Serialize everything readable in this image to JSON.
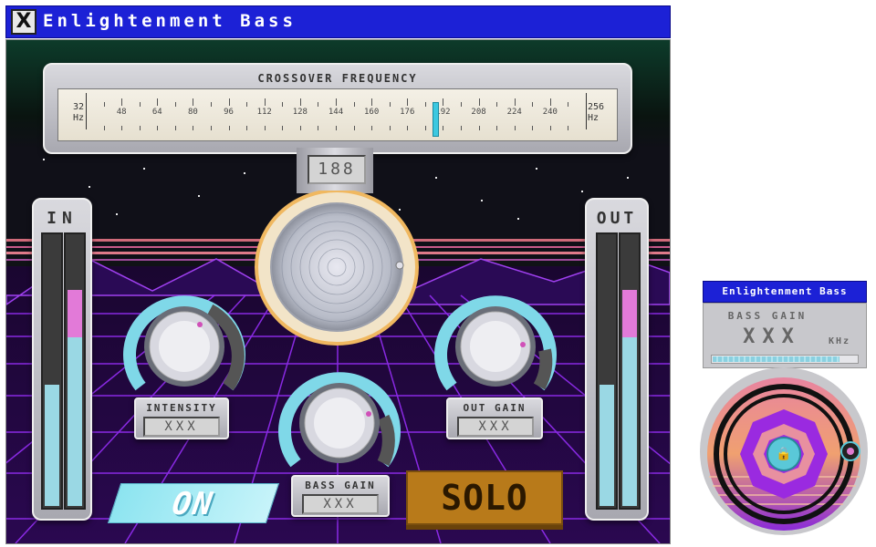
{
  "main_window": {
    "title": "Enlightenment Bass",
    "close_glyph": "X"
  },
  "crossover": {
    "label": "CROSSOVER FREQUENCY",
    "min_label": "32",
    "min_unit": "Hz",
    "max_label": "256",
    "max_unit": "Hz",
    "ticks": [
      "48",
      "64",
      "80",
      "96",
      "112",
      "128",
      "144",
      "160",
      "176",
      "192",
      "208",
      "224",
      "240"
    ],
    "value_display": "188",
    "value": 188
  },
  "in_meter": {
    "label": "IN",
    "left_level": 0.45,
    "right_level": 0.8
  },
  "out_meter": {
    "label": "OUT",
    "left_level": 0.45,
    "right_level": 0.8
  },
  "knobs": {
    "intensity": {
      "label": "INTENSITY",
      "value": "XXX"
    },
    "bass_gain": {
      "label": "BASS GAIN",
      "value": "XXX"
    },
    "out_gain": {
      "label": "OUT GAIN",
      "value": "XXX"
    }
  },
  "buttons": {
    "on": "ON",
    "solo": "SOLO"
  },
  "small_window": {
    "title": "Enlightenment Bass",
    "label": "BASS GAIN",
    "value": "XXX",
    "unit": "KHz",
    "level": 0.88
  },
  "colors": {
    "titlebar": "#1c21d6",
    "accent_cyan": "#7fd8e8",
    "accent_pink": "#e07ad0",
    "grid_purple": "#8a2be2",
    "solo_orange": "#b87a1a"
  },
  "icons": [
    "close-icon",
    "lock-icon",
    "knob-icon"
  ]
}
